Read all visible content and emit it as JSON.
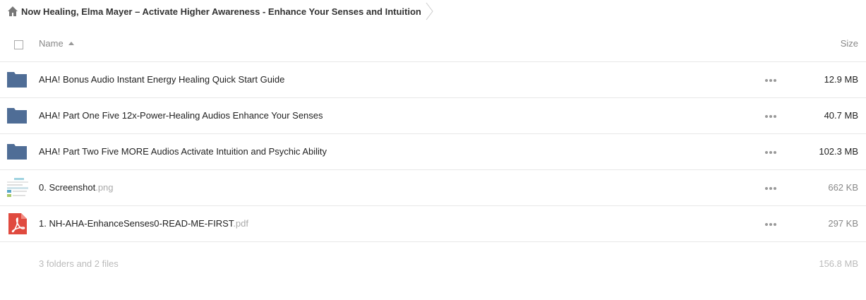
{
  "breadcrumb": {
    "home_icon": "home-icon",
    "title": "Now Healing, Elma Mayer – Activate Higher Awareness - Enhance Your Senses and Intuition"
  },
  "header": {
    "name_label": "Name",
    "size_label": "Size",
    "sort_icon": "sort-ascending-icon"
  },
  "rows": [
    {
      "type": "folder",
      "icon": "folder-icon",
      "name": "AHA! Bonus Audio Instant Energy Healing Quick Start Guide",
      "ext": "",
      "size": "12.9 MB"
    },
    {
      "type": "folder",
      "icon": "folder-icon",
      "name": "AHA! Part One Five 12x-Power-Healing Audios Enhance Your Senses",
      "ext": "",
      "size": "40.7 MB"
    },
    {
      "type": "folder",
      "icon": "folder-icon",
      "name": "AHA! Part Two Five MORE Audios Activate Intuition and Psychic Ability",
      "ext": "",
      "size": "102.3 MB"
    },
    {
      "type": "image",
      "icon": "image-thumbnail-icon",
      "name": "0. Screenshot",
      "ext": ".png",
      "size": "662 KB"
    },
    {
      "type": "pdf",
      "icon": "pdf-icon",
      "name": "1. NH-AHA-EnhanceSenses0-READ-ME-FIRST",
      "ext": ".pdf",
      "size": "297 KB"
    }
  ],
  "summary": {
    "counts": "3 folders and 2 files",
    "total_size": "156.8 MB"
  },
  "colors": {
    "folder": "#4f6d96",
    "pdf": "#e04a3f",
    "divider": "#e8e8e8"
  }
}
